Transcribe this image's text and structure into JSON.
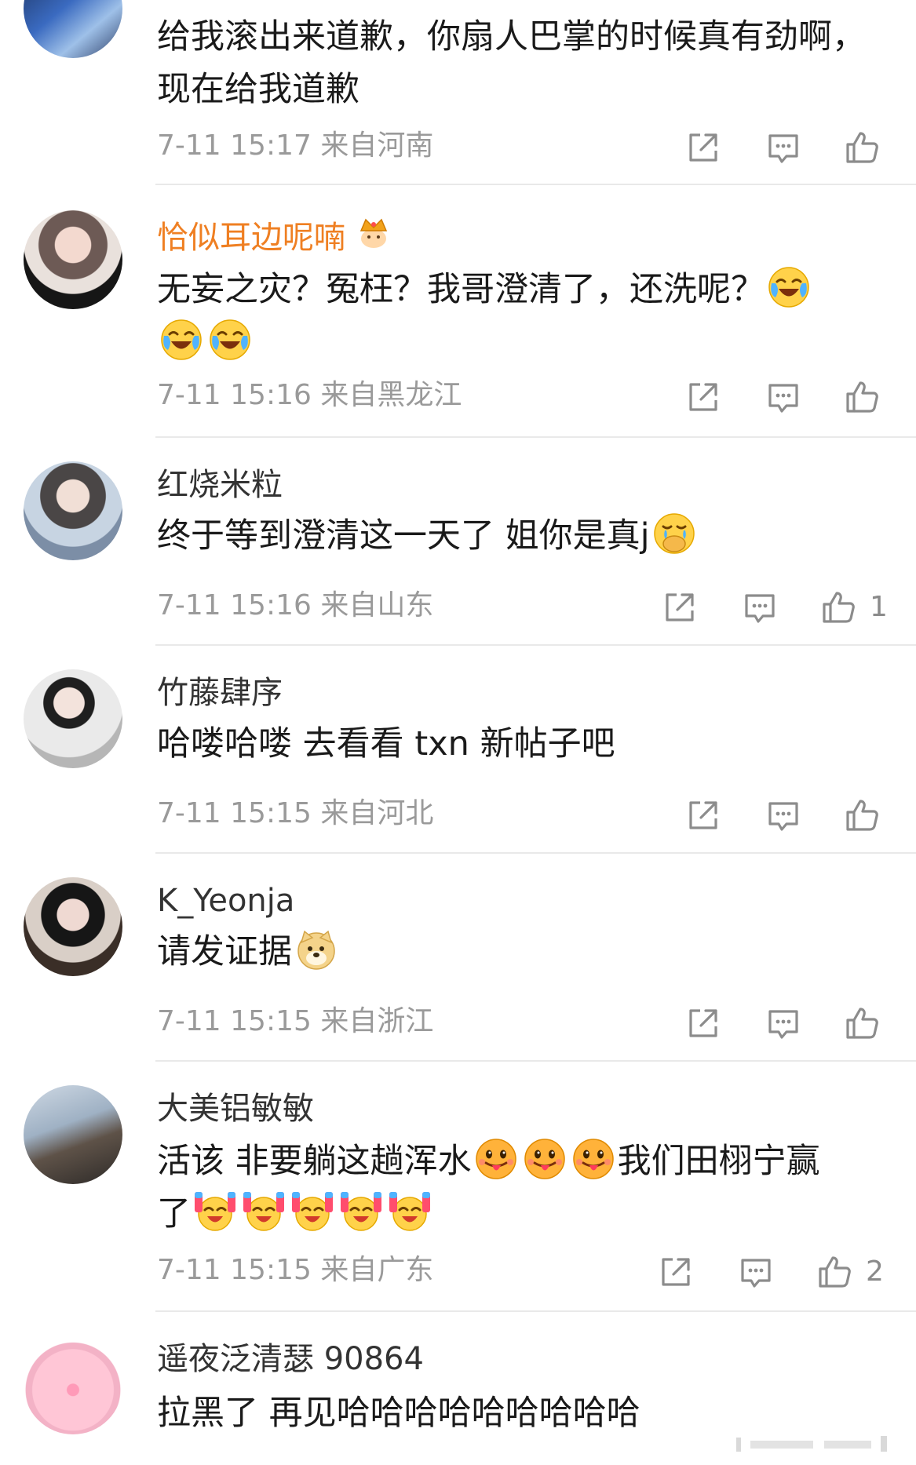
{
  "comments": [
    {
      "text": "给我滚出来道歉，你扇人巴掌的时候真有劲啊，现在给我道歉",
      "time": "7-11 15:17",
      "location": "来自河南"
    },
    {
      "username": "恰似耳边呢喃",
      "text": "无妄之灾？冤枉？我哥澄清了，还洗呢？",
      "emoji": "laugh-cry-emoji",
      "time": "7-11 15:16",
      "location": "来自黑龙江"
    },
    {
      "username": "红烧米粒",
      "text": "终于等到澄清这一天了 姐你是真j",
      "emoji": "cry-cover-mouth-emoji",
      "time": "7-11 15:16",
      "location": "来自山东",
      "likes": "1"
    },
    {
      "username": "竹藤肆序",
      "text": "哈喽哈喽 去看看 txn 新帖子吧",
      "time": "7-11 15:15",
      "location": "来自河北"
    },
    {
      "username": "K_Yeonja",
      "text": "请发证据",
      "emoji": "doge-emoji",
      "time": "7-11 15:15",
      "location": "来自浙江"
    },
    {
      "username": "大美铝敏敏",
      "text_part1": "活该 非要躺这趟浑水",
      "text_part2": "我们田栩宁赢",
      "text_part3": "了",
      "emoji1": "tongue-out-emoji",
      "emoji2": "cheering-cry-emoji",
      "time": "7-11 15:15",
      "location": "来自广东",
      "likes": "2"
    },
    {
      "username": "遥夜泛清瑟 90864",
      "text": "拉黑了 再见哈哈哈哈哈哈哈哈哈"
    }
  ],
  "icons": {
    "share": "share-icon",
    "comment": "comment-icon",
    "like": "like-icon",
    "crown": "crown-badge-icon"
  },
  "colors": {
    "vip_name": "#ef7f22",
    "meta": "#9a9a9a",
    "icon": "#8c8c8c"
  }
}
